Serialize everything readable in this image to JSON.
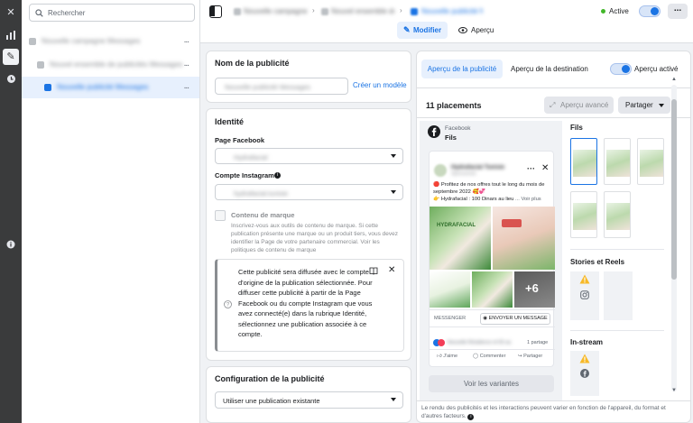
{
  "rail": {
    "icons": [
      "close-icon",
      "chart-icon",
      "pencil-icon",
      "clock-icon",
      "info-icon"
    ]
  },
  "tree": {
    "search_placeholder": "Rechercher",
    "items": [
      {
        "label": "Nouvelle campagne Messages",
        "color": "#bcc0c4"
      },
      {
        "label": "Nouvel ensemble de publicités Messages",
        "color": "#bcc0c4"
      },
      {
        "label": "Nouvelle publicité Messages",
        "color": "#1b74e4"
      }
    ],
    "more": "..."
  },
  "topbar": {
    "crumbs": [
      "Nouvelle campagne Messages",
      "Nouvel ensemble de publicités",
      "Nouvelle publicité Messages"
    ],
    "edit_label": "Modifier",
    "preview_label": "Aperçu",
    "status_label": "Active",
    "status_color": "#42b72a",
    "more": "..."
  },
  "ad_name": {
    "title": "Nom de la publicité",
    "value": "Nouvelle publicité Messages",
    "create_template": "Créer un modèle"
  },
  "identity": {
    "title": "Identité",
    "fb_page_label": "Page Facebook",
    "fb_page_value": "Hydrafacial",
    "ig_label": "Compte Instagram",
    "ig_value": "hydrafacial.tunisie",
    "brand_label": "Contenu de marque",
    "brand_note": "Inscrivez-vous aux outils de contenu de marque. Si cette publication présente une marque ou un produit tiers, vous devez identifier la Page de votre partenaire commercial. Voir les politiques de contenu de marque",
    "info_text": "Cette publicité sera diffusée avec le compte d'origine de la publication sélectionnée. Pour diffuser cette publicité à partir de la Page Facebook ou du compte Instagram que vous avez connecté(e) dans la rubrique Identité, sélectionnez une publication associée à ce compte."
  },
  "config": {
    "title": "Configuration de la publicité",
    "value": "Utiliser une publication existante"
  },
  "preview": {
    "tab_ad": "Aperçu de la publicité",
    "tab_dest": "Aperçu de la destination",
    "toggle_label": "Aperçu activé",
    "placements": "11 placements",
    "advanced": "Aperçu avancé",
    "share": "Partager",
    "platform": "Facebook",
    "feed": "Fils",
    "post_name": "Hydrafacial Tunisie",
    "post_sub": "Sponsorisé",
    "post_text": "🔴 Profitez de nos offres tout le long du mois de septembre 2022 🥰💞",
    "post_text2": "👉 Hydrafacial : 100 Dinars au lieu",
    "see_more": "... Voir plus",
    "messenger": "MESSENGER",
    "send_message": "ENVOYER UN MESSAGE",
    "reactions": "Nouvelle Résidence et 55 autres",
    "shares": "1 partage",
    "like": "J'aime",
    "comment": "Commenter",
    "share_action": "Partager",
    "plus_count": "+6",
    "variants": "Voir les variantes",
    "right_feed": "Fils",
    "stories": "Stories et Reels",
    "instream": "In-stream",
    "footer": "Le rendu des publicités et les interactions peuvent varier en fonction de l'appareil, du format et d'autres facteurs."
  },
  "colors": {
    "accent": "#1b74e4",
    "rail": "#3a3b3c",
    "warning": "#f7b928"
  }
}
